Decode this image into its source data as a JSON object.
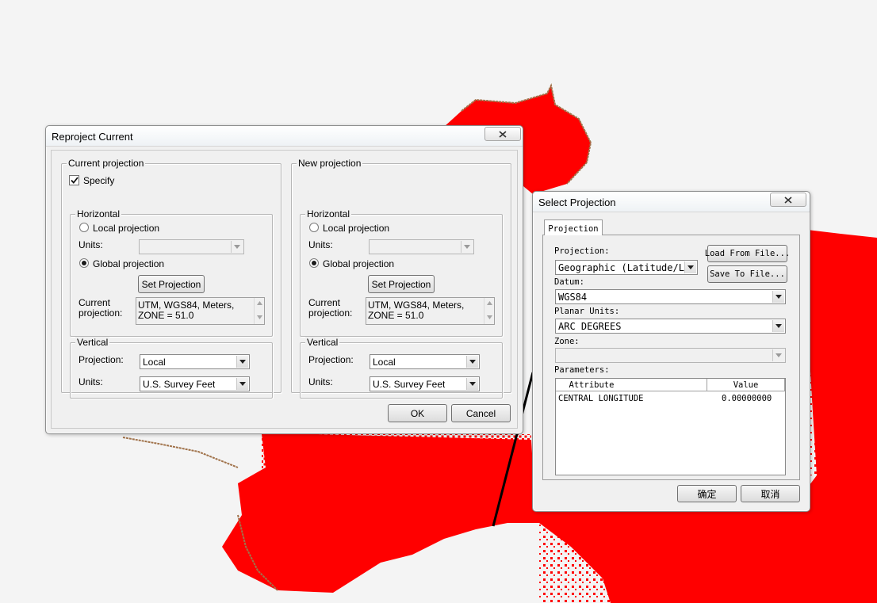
{
  "reproject": {
    "title": "Reproject Current",
    "current": {
      "legend": "Current projection",
      "specify_label": "Specify",
      "specify_checked": true,
      "horizontal": {
        "legend": "Horizontal",
        "local_label": "Local projection",
        "units_label": "Units:",
        "units_value": "",
        "global_label": "Global projection",
        "selected": "global",
        "set_projection_label": "Set Projection",
        "current_label_line1": "Current",
        "current_label_line2": "projection:",
        "current_value_line1": "UTM, WGS84, Meters,",
        "current_value_line2": "ZONE = 51.0"
      },
      "vertical": {
        "legend": "Vertical",
        "projection_label": "Projection:",
        "projection_value": "Local",
        "units_label": "Units:",
        "units_value": "U.S. Survey Feet"
      }
    },
    "new": {
      "legend": "New projection",
      "horizontal": {
        "legend": "Horizontal",
        "local_label": "Local projection",
        "units_label": "Units:",
        "units_value": "",
        "global_label": "Global projection",
        "selected": "global",
        "set_projection_label": "Set Projection",
        "current_label_line1": "Current",
        "current_label_line2": "projection:",
        "current_value_line1": "UTM, WGS84, Meters,",
        "current_value_line2": "ZONE = 51.0"
      },
      "vertical": {
        "legend": "Vertical",
        "projection_label": "Projection:",
        "projection_value": "Local",
        "units_label": "Units:",
        "units_value": "U.S. Survey Feet"
      }
    },
    "ok_label": "OK",
    "cancel_label": "Cancel"
  },
  "select_projection": {
    "title": "Select Projection",
    "tab_label": "Projection",
    "projection_label": "Projection:",
    "projection_value": "Geographic (Latitude/Longi",
    "load_label": "Load From File...",
    "save_label": "Save To File...",
    "datum_label": "Datum:",
    "datum_value": "WGS84",
    "planar_units_label": "Planar Units:",
    "planar_units_value": "ARC DEGREES",
    "zone_label": "Zone:",
    "zone_value": "",
    "parameters_label": "Parameters:",
    "columns": [
      "Attribute",
      "Value"
    ],
    "rows": [
      {
        "attribute": "CENTRAL LONGITUDE",
        "value": "0.00000000"
      }
    ],
    "ok_label": "确定",
    "cancel_label": "取消"
  },
  "colors": {
    "map_fill": "#ff0000",
    "coastline": "#a0724a",
    "background": "#f4f4f4"
  }
}
